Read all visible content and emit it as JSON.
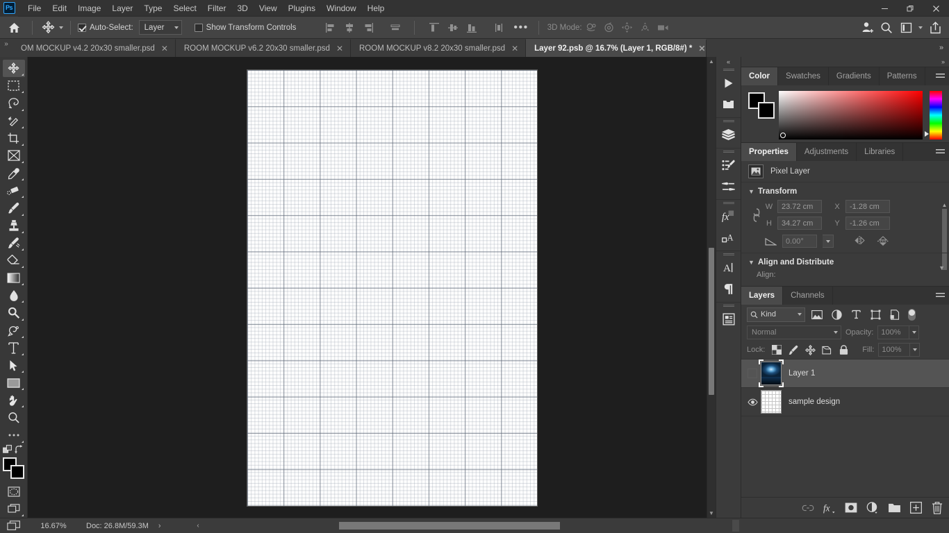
{
  "app": {
    "name": "Adobe Photoshop",
    "logo_text": "Ps"
  },
  "menubar": {
    "items": [
      {
        "label": "File"
      },
      {
        "label": "Edit"
      },
      {
        "label": "Image"
      },
      {
        "label": "Layer"
      },
      {
        "label": "Type"
      },
      {
        "label": "Select"
      },
      {
        "label": "Filter"
      },
      {
        "label": "3D"
      },
      {
        "label": "View"
      },
      {
        "label": "Plugins"
      },
      {
        "label": "Window"
      },
      {
        "label": "Help"
      }
    ],
    "window_controls": {
      "minimize": "—",
      "maximize": "❐",
      "close": "✕"
    }
  },
  "options_bar": {
    "tool_name": "move-tool",
    "auto_select_label": "Auto-Select:",
    "auto_select_checked": true,
    "auto_select_scope": "Layer",
    "show_transform_label": "Show Transform Controls",
    "show_transform_checked": false,
    "more_options": "•••",
    "mode_3d_label": "3D Mode:",
    "align_buttons": [
      "align-left-edges",
      "align-horizontal-centers",
      "align-right-edges",
      "align-middle"
    ],
    "distribute_buttons": [
      "align-top-edges",
      "align-vertical-centers",
      "align-bottom-edges",
      "distribute-horizontal"
    ],
    "right_buttons": [
      "share-user-icon",
      "search-icon",
      "workspace-icon",
      "export-icon"
    ]
  },
  "tabs": {
    "overflow_left": "»",
    "overflow_right": "»",
    "items": [
      {
        "label": "OM MOCKUP v4.2 20x30 smaller.psd",
        "active": false,
        "close": "✕"
      },
      {
        "label": "ROOM MOCKUP v6.2 20x30 smaller.psd",
        "active": false,
        "close": "✕"
      },
      {
        "label": "ROOM MOCKUP v8.2 20x30 smaller.psd",
        "active": false,
        "close": "✕"
      },
      {
        "label": "Layer 92.psb @ 16.7% (Layer 1, RGB/8#) *",
        "active": true,
        "close": "✕"
      }
    ]
  },
  "toolbar": {
    "tools": [
      {
        "name": "move-tool",
        "selected": true
      },
      {
        "name": "rectangular-marquee-tool",
        "selected": false
      },
      {
        "name": "lasso-tool",
        "selected": false
      },
      {
        "name": "object-selection-tool",
        "selected": false
      },
      {
        "name": "crop-tool",
        "selected": false
      },
      {
        "name": "frame-tool",
        "selected": false
      },
      {
        "name": "eyedropper-tool",
        "selected": false
      },
      {
        "name": "spot-healing-brush-tool",
        "selected": false
      },
      {
        "name": "brush-tool",
        "selected": false
      },
      {
        "name": "clone-stamp-tool",
        "selected": false
      },
      {
        "name": "history-brush-tool",
        "selected": false
      },
      {
        "name": "eraser-tool",
        "selected": false
      },
      {
        "name": "gradient-tool",
        "selected": false
      },
      {
        "name": "blur-tool",
        "selected": false
      },
      {
        "name": "dodge-tool",
        "selected": false
      },
      {
        "name": "pen-tool",
        "selected": false
      },
      {
        "name": "horizontal-type-tool",
        "selected": false
      },
      {
        "name": "path-selection-tool",
        "selected": false
      },
      {
        "name": "rectangle-tool",
        "selected": false
      },
      {
        "name": "hand-tool",
        "selected": false
      },
      {
        "name": "zoom-tool",
        "selected": false
      },
      {
        "name": "edit-toolbar-tool",
        "selected": false
      }
    ],
    "foreground_color": "#000000",
    "background_color": "#000000",
    "quick_mask": "quick-mask-mode",
    "screen_mode": "screen-mode"
  },
  "canvas": {
    "document_kind": "graph-paper-grid",
    "background_color": "#1e1e1e",
    "sheet_color": "#fdfdfd"
  },
  "icon_dock": {
    "collapse": "«",
    "groups": [
      [
        "actions-play-icon",
        "history-icon"
      ],
      [
        "layer-comps-icon"
      ],
      [
        "brush-settings-icon",
        "brushes-icon"
      ],
      [
        "layer-styles-fx-icon",
        "character-styles-icon"
      ],
      [
        "character-icon",
        "paragraph-icon"
      ],
      [
        "notes-icon"
      ]
    ]
  },
  "color_panel": {
    "tabs": [
      {
        "label": "Color",
        "active": true
      },
      {
        "label": "Swatches",
        "active": false
      },
      {
        "label": "Gradients",
        "active": false
      },
      {
        "label": "Patterns",
        "active": false
      }
    ],
    "foreground": "#000000",
    "background": "#000000",
    "hue": "#ff0000",
    "menu_icon": "panel-menu-icon"
  },
  "properties_panel": {
    "tabs": [
      {
        "label": "Properties",
        "active": true
      },
      {
        "label": "Adjustments",
        "active": false
      },
      {
        "label": "Libraries",
        "active": false
      }
    ],
    "layer_kind": "Pixel Layer",
    "layer_kind_icon": "pixel-layer-icon",
    "transform": {
      "section_title": "Transform",
      "w_label": "W",
      "w_value": "23.72 cm",
      "h_label": "H",
      "h_value": "34.27 cm",
      "x_label": "X",
      "x_value": "-1.28 cm",
      "y_label": "Y",
      "y_value": "-1.26 cm",
      "angle_value": "0.00°",
      "link_icon": "link-wh-icon",
      "angle_icon": "angle-icon",
      "flip_horizontal_icon": "flip-horizontal-icon",
      "flip_vertical_icon": "flip-vertical-icon"
    },
    "align_distribute": {
      "section_title": "Align and Distribute",
      "align_label": "Align:"
    }
  },
  "layers_panel": {
    "tabs": [
      {
        "label": "Layers",
        "active": true
      },
      {
        "label": "Channels",
        "active": false
      }
    ],
    "filter": {
      "kind_label": "Kind",
      "search_icon": "search-icon",
      "type_filters": [
        "pixel-filter-icon",
        "adjustment-filter-icon",
        "type-filter-icon",
        "shape-filter-icon",
        "smart-object-filter-icon"
      ],
      "toggle": "filter-enable-toggle"
    },
    "blend_mode": "Normal",
    "opacity_label": "Opacity:",
    "opacity_value": "100%",
    "lock_label": "Lock:",
    "lock_buttons": [
      "lock-transparent-pixels-icon",
      "lock-image-pixels-icon",
      "lock-position-icon",
      "lock-artboard-nesting-icon",
      "lock-all-icon"
    ],
    "fill_label": "Fill:",
    "fill_value": "100%",
    "layers": [
      {
        "name": "Layer 1",
        "visible": false,
        "selected": true,
        "thumb": "photo"
      },
      {
        "name": "sample design",
        "visible": true,
        "selected": false,
        "thumb": "grid"
      }
    ],
    "footer_buttons": [
      "link-layers-icon",
      "add-layer-style-icon",
      "add-layer-mask-icon",
      "new-fill-adjustment-icon",
      "new-group-icon",
      "new-layer-icon",
      "delete-layer-icon"
    ],
    "footer_fx_label": "fx"
  },
  "status_bar": {
    "screen_mode_icon": "screen-mode-icon",
    "zoom_level": "16.67%",
    "doc_info": "Doc: 26.8M/59.3M",
    "expand_arrow": "›",
    "scroll_left": "‹",
    "scroll_right": "›"
  },
  "colors": {
    "menu_bg": "#333333",
    "options_bg": "#444444",
    "panel_bg": "#3b3b3b",
    "canvas_bg": "#1e1e1e",
    "tab_active_bg": "#4a4a4a",
    "accent": "#31a8ff"
  }
}
